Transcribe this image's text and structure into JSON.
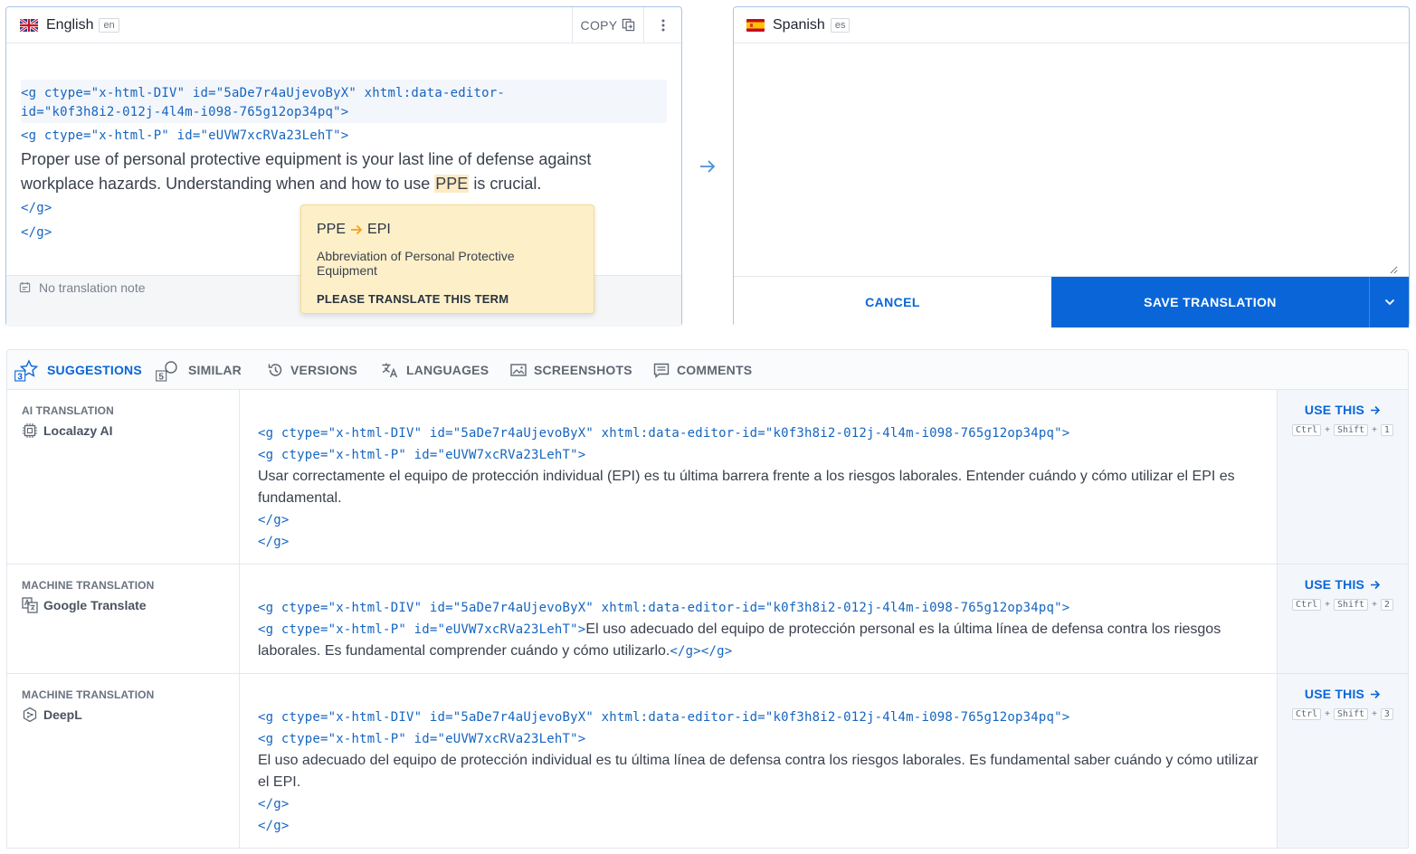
{
  "source": {
    "language": "English",
    "code": "en",
    "copy_label": "COPY",
    "lines": [
      {
        "kind": "tag",
        "text": "<g ctype=\"x-html-DIV\" id=\"5aDe7r4aUjevoByX\" xhtml:data-editor-"
      },
      {
        "kind": "tag",
        "text": "id=\"k0f3h8i2-012j-4l4m-i098-765g12op34pq\">"
      },
      {
        "kind": "tag",
        "text": "<g ctype=\"x-html-P\" id=\"eUVW7xcRVa23LehT\">"
      }
    ],
    "text_line1": "Proper use of personal protective equipment is your last line of defense against",
    "text_line2_before": "workplace hazards. Understanding when and how to use ",
    "text_term": "PPE",
    "text_line2_after": " is crucial.",
    "close1": "</g>",
    "close2": "</g>",
    "note": "No translation note"
  },
  "glossary_popup": {
    "term": "PPE",
    "translation": "EPI",
    "description": "Abbreviation of Personal Protective Equipment",
    "instruction": "PLEASE TRANSLATE THIS TERM"
  },
  "target": {
    "language": "Spanish",
    "code": "es",
    "value": "",
    "cancel_label": "CANCEL",
    "save_label": "SAVE TRANSLATION"
  },
  "tabs": [
    {
      "label": "SUGGESTIONS",
      "badge": "3",
      "active": true,
      "icon": "star-icon"
    },
    {
      "label": "SIMILAR",
      "badge": "5",
      "active": false,
      "icon": "search-icon"
    },
    {
      "label": "VERSIONS",
      "active": false,
      "icon": "history-icon"
    },
    {
      "label": "LANGUAGES",
      "active": false,
      "icon": "translate-icon"
    },
    {
      "label": "SCREENSHOTS",
      "active": false,
      "icon": "image-icon"
    },
    {
      "label": "COMMENTS",
      "active": false,
      "icon": "comment-icon"
    }
  ],
  "suggestions": [
    {
      "kind": "AI TRANSLATION",
      "engine": "Localazy AI",
      "tag1": "<g ctype=\"x-html-DIV\" id=\"5aDe7r4aUjevoByX\" xhtml:data-editor-id=\"k0f3h8i2-012j-4l4m-i098-765g12op34pq\">",
      "tag2": "<g ctype=\"x-html-P\" id=\"eUVW7xcRVa23LehT\">",
      "text1": "Usar correctamente el equipo de protección individual (EPI) es tu última barrera frente a los riesgos laborales. Entender cuándo y cómo utilizar el EPI es",
      "text2": "fundamental.",
      "close1": "</g>",
      "close2": "</g>",
      "use_label": "USE THIS",
      "shortcut": [
        "Ctrl",
        "+",
        "Shift",
        "+",
        "1"
      ]
    },
    {
      "kind": "MACHINE TRANSLATION",
      "engine": "Google Translate",
      "tag1": "<g ctype=\"x-html-DIV\" id=\"5aDe7r4aUjevoByX\" xhtml:data-editor-id=\"k0f3h8i2-012j-4l4m-i098-765g12op34pq\">",
      "tag2": "<g ctype=\"x-html-P\" id=\"eUVW7xcRVa23LehT\">",
      "text1": "El uso adecuado del equipo de protección personal es la última línea de defensa contra los riesgos",
      "text2": "laborales. Es fundamental comprender cuándo y cómo utilizarlo.",
      "close_inline": "</g></g>",
      "use_label": "USE THIS",
      "shortcut": [
        "Ctrl",
        "+",
        "Shift",
        "+",
        "2"
      ]
    },
    {
      "kind": "MACHINE TRANSLATION",
      "engine": "DeepL",
      "tag1": "<g ctype=\"x-html-DIV\" id=\"5aDe7r4aUjevoByX\" xhtml:data-editor-id=\"k0f3h8i2-012j-4l4m-i098-765g12op34pq\">",
      "tag2": "<g ctype=\"x-html-P\" id=\"eUVW7xcRVa23LehT\">",
      "text1": "El uso adecuado del equipo de protección individual es tu última línea de defensa contra los riesgos laborales. Es fundamental saber cuándo y cómo utilizar",
      "text2": "el EPI.",
      "close1": "</g>",
      "close2": "</g>",
      "use_label": "USE THIS",
      "shortcut": [
        "Ctrl",
        "+",
        "Shift",
        "+",
        "3"
      ]
    }
  ],
  "colors": {
    "accent": "#0a66d8",
    "tag": "#1565c0",
    "highlight": "#fdebc4",
    "popup": "#fdf0c9"
  }
}
